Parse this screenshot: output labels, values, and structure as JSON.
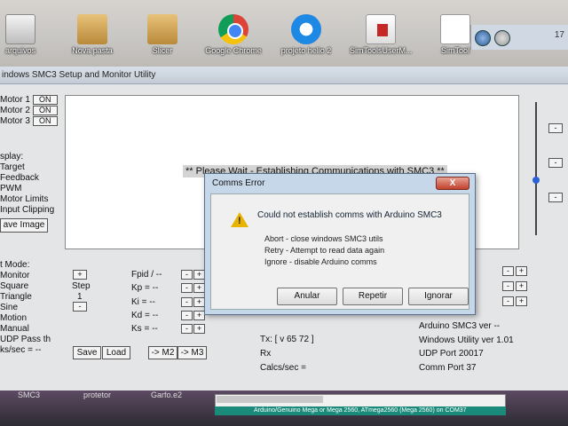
{
  "desktop": {
    "icons": [
      {
        "label": "arquivos"
      },
      {
        "label": "Nova pasta"
      },
      {
        "label": "Slicer"
      },
      {
        "label": "Google Chrome"
      },
      {
        "label": "projeto helio 2"
      },
      {
        "label": "SimToolsUserM..."
      },
      {
        "label": "SimTool"
      }
    ],
    "nav_right_text": "17"
  },
  "window": {
    "title": "indows SMC3 Setup and Monitor Utility"
  },
  "motors": [
    {
      "label": "Motor 1",
      "state": "ON"
    },
    {
      "label": "Motor 2",
      "state": "ON"
    },
    {
      "label": "Motor 3",
      "state": "ON"
    }
  ],
  "display": {
    "wait_message": "** Please Wait - Establishing Communications with SMC3 **"
  },
  "display_options": {
    "heading": "splay:",
    "items": [
      "Target",
      "Feedback",
      "PWM",
      "Motor Limits",
      "Input Clipping"
    ],
    "save_image": "ave Image"
  },
  "test_mode": {
    "heading": "t Mode:",
    "items": [
      "Monitor",
      "Square",
      "Triangle",
      "Sine",
      "Motion",
      "Manual",
      "UDP Pass th"
    ],
    "kms": "ks/sec = --",
    "step_label": "Step",
    "step_value": "1"
  },
  "pid": {
    "fpid": "Fpid / --",
    "kp": "Kp = --",
    "ki": "Ki = --",
    "kd": "Kd = --",
    "ks": "Ks = --"
  },
  "buttons": {
    "save": "Save",
    "load": "Load",
    "to_m2": "-> M2",
    "to_m3": "-> M3",
    "plus": "+",
    "minus": "-"
  },
  "status": {
    "tx": "Tx: [ v 65 72 ]",
    "rx": "Rx",
    "calcs": "Calcs/sec =",
    "arduino_ver": "Arduino SMC3 ver --",
    "win_ver": "Windows Utility ver 1.01",
    "udp_port": "UDP Port 20017",
    "comm_port": "Comm Port 37"
  },
  "dialog": {
    "title": "Comms Error",
    "close": "X",
    "message": "Could not establish comms with Arduino SMC3",
    "lines": [
      "Abort - close windows SMC3 utils",
      "Retry - Attempt to read data again",
      "Ignore - disable Arduino comms"
    ],
    "buttons": {
      "abort": "Anular",
      "retry": "Repetir",
      "ignore": "Ignorar"
    }
  },
  "bottom": {
    "labels": [
      "SMC3",
      "protetor",
      "Garfo.e2"
    ],
    "console_status": "Arduino/Genuino Mega or Mega 2560, ATmega2560 (Mega 2560) on COM37"
  }
}
